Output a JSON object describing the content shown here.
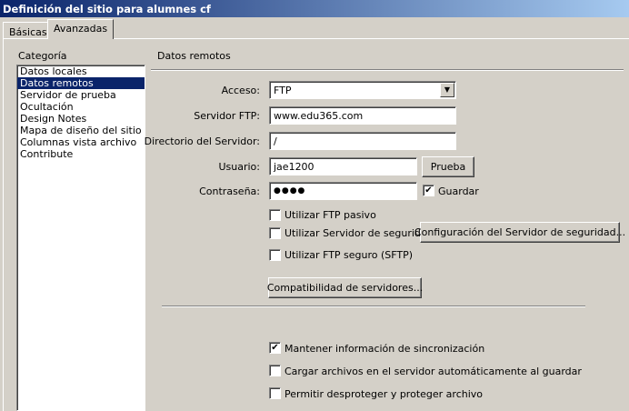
{
  "window": {
    "title": "Definición del sitio para alumnes cf"
  },
  "tabs": [
    {
      "label": "Básicas",
      "active": false
    },
    {
      "label": "Avanzadas",
      "active": true
    }
  ],
  "category": {
    "heading": "Categoría",
    "items": [
      "Datos locales",
      "Datos remotos",
      "Servidor de prueba",
      "Ocultación",
      "Design Notes",
      "Mapa de diseño del sitio",
      "Columnas vista archivo",
      "Contribute"
    ],
    "selected_index": 1
  },
  "section": {
    "title": "Datos remotos"
  },
  "form": {
    "acceso_label": "Acceso:",
    "acceso_value": "FTP",
    "servidor_label": "Servidor FTP:",
    "servidor_value": "www.edu365.com",
    "directorio_label": "Directorio del Servidor:",
    "directorio_value": "/",
    "usuario_label": "Usuario:",
    "usuario_value": "jae1200",
    "prueba_button": "Prueba",
    "password_label": "Contraseña:",
    "password_value": "●●●●",
    "guardar_label": "Guardar",
    "guardar_checked": true
  },
  "options": {
    "ftp_pasivo": {
      "label": "Utilizar FTP pasivo",
      "checked": false
    },
    "servidor_seguridad": {
      "label": "Utilizar Servidor de seguridad",
      "checked": false
    },
    "config_seguridad_button": "Configuración del Servidor de seguridad...",
    "ftp_seguro": {
      "label": "Utilizar FTP seguro (SFTP)",
      "checked": false
    },
    "compatibilidad_button": "Compatibilidad de servidores...",
    "sincronizacion": {
      "label": "Mantener información de sincronización",
      "checked": true
    },
    "cargar_auto": {
      "label": "Cargar archivos en el servidor automáticamente al guardar",
      "checked": false
    },
    "desproteger": {
      "label": "Permitir desproteger y proteger archivo",
      "checked": false
    }
  },
  "glyphs": {
    "check": "✔",
    "dropdown_arrow": "▼"
  }
}
